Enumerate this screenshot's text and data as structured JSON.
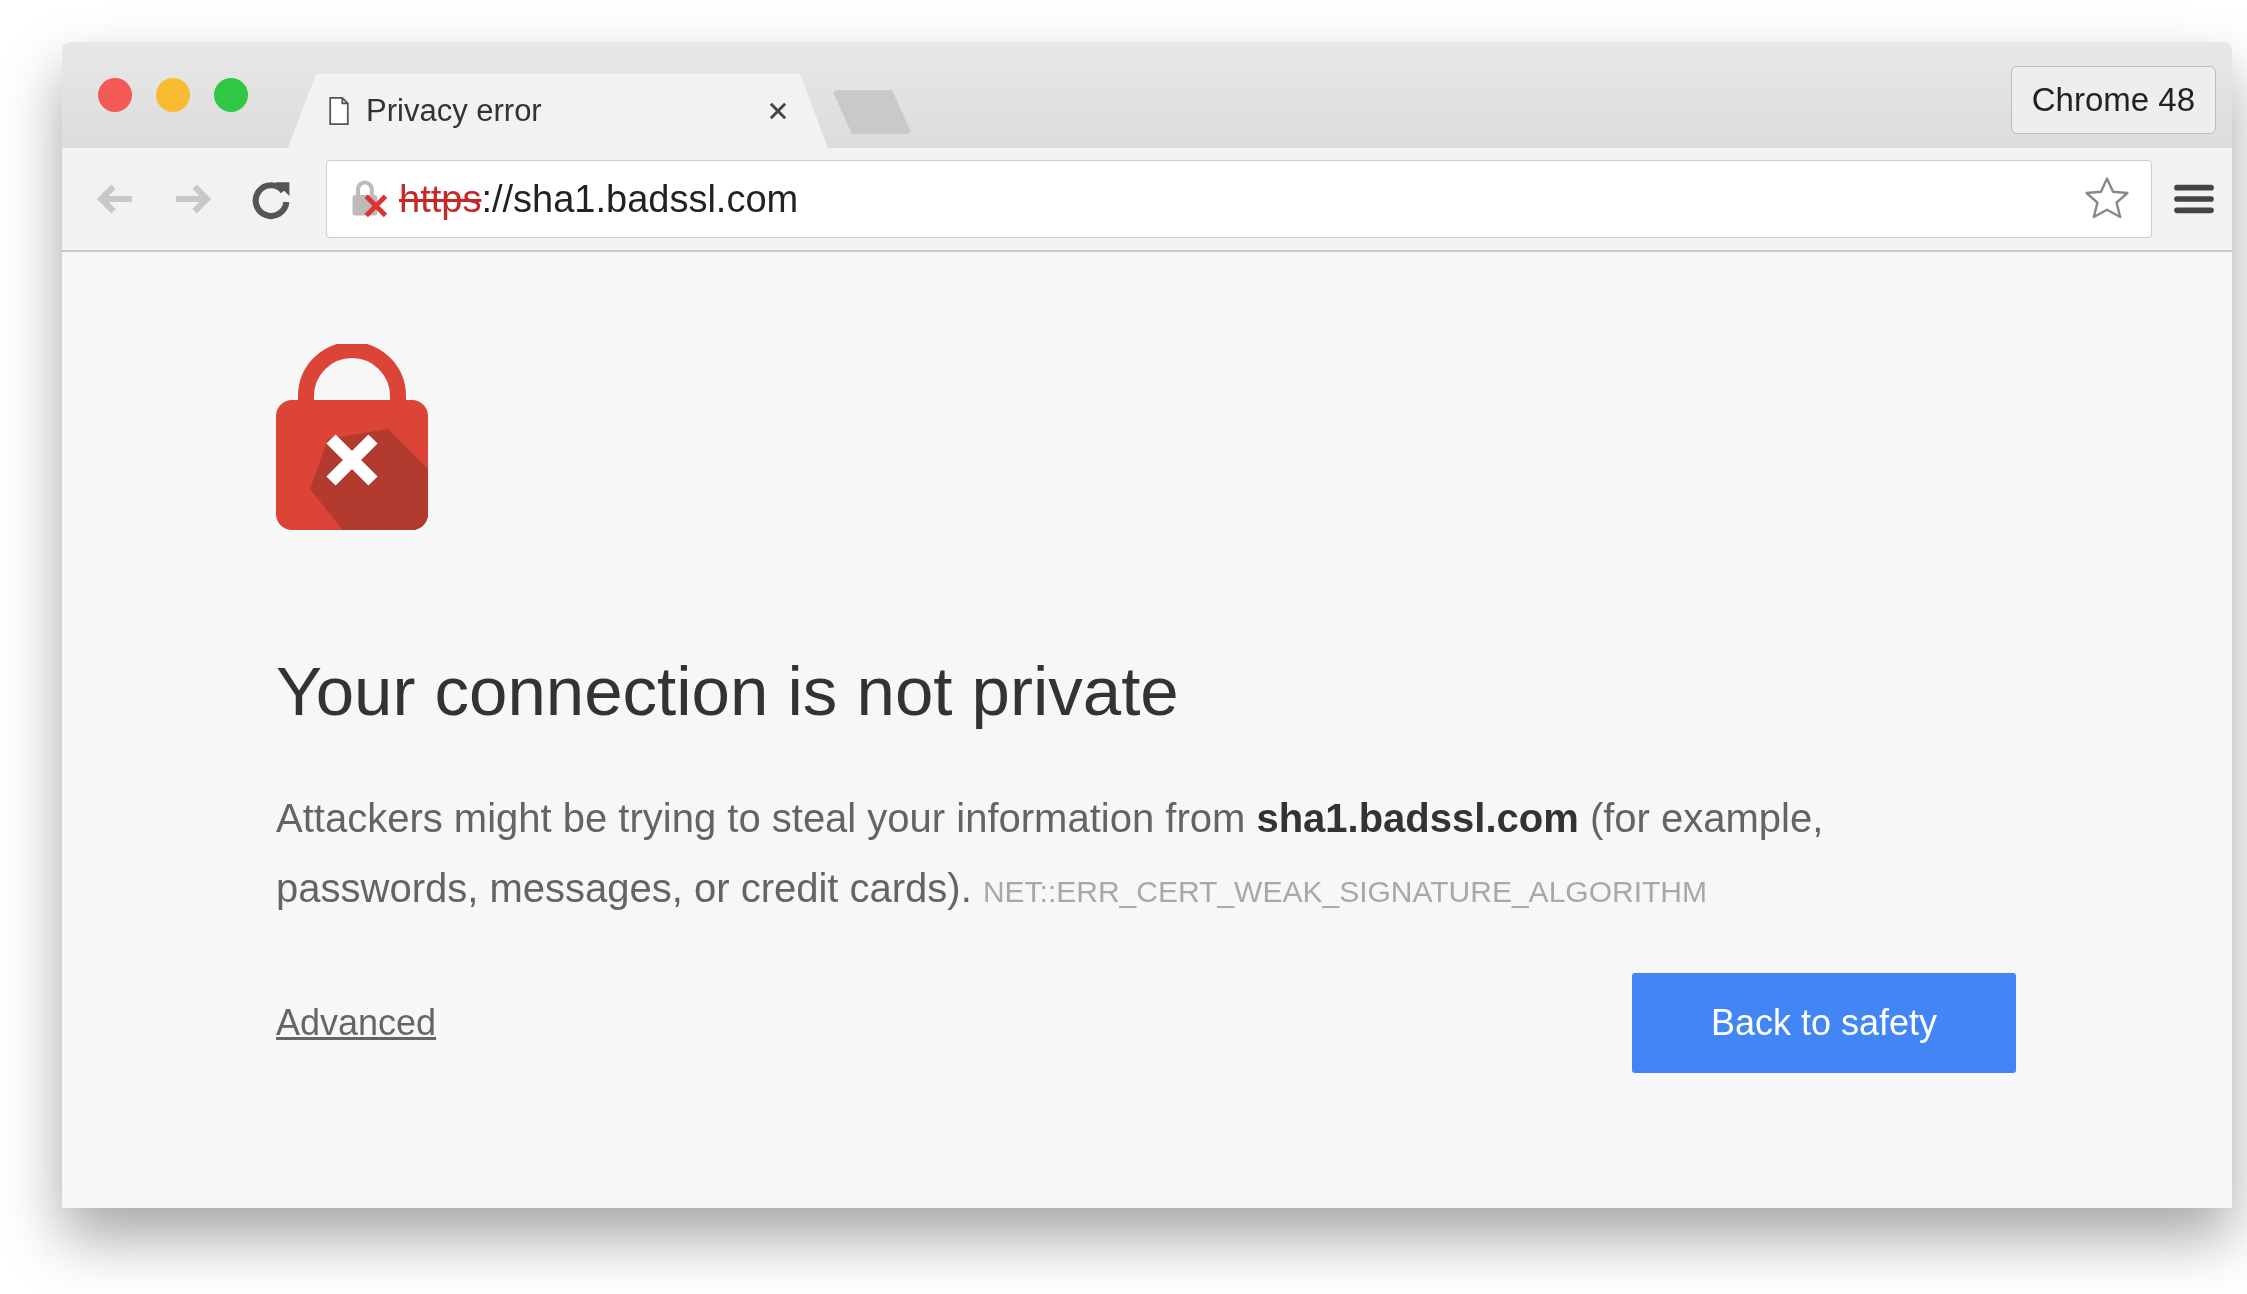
{
  "window": {
    "tabs": [
      {
        "title": "Privacy error",
        "selected": true
      }
    ],
    "profile_button": "Chrome 48"
  },
  "address_bar": {
    "scheme": "https",
    "rest": "://sha1.badssl.com"
  },
  "page": {
    "heading": "Your connection is not private",
    "description": "Attackers might be trying to steal your information from **sha1.badssl.com** (for example, passwords, messages, or credit cards).",
    "error_code": "NET::ERR_CERT_WEAK_SIGNATURE_ALGORITHM",
    "advanced_link": "Advanced",
    "primary_button": "Back to safety"
  }
}
